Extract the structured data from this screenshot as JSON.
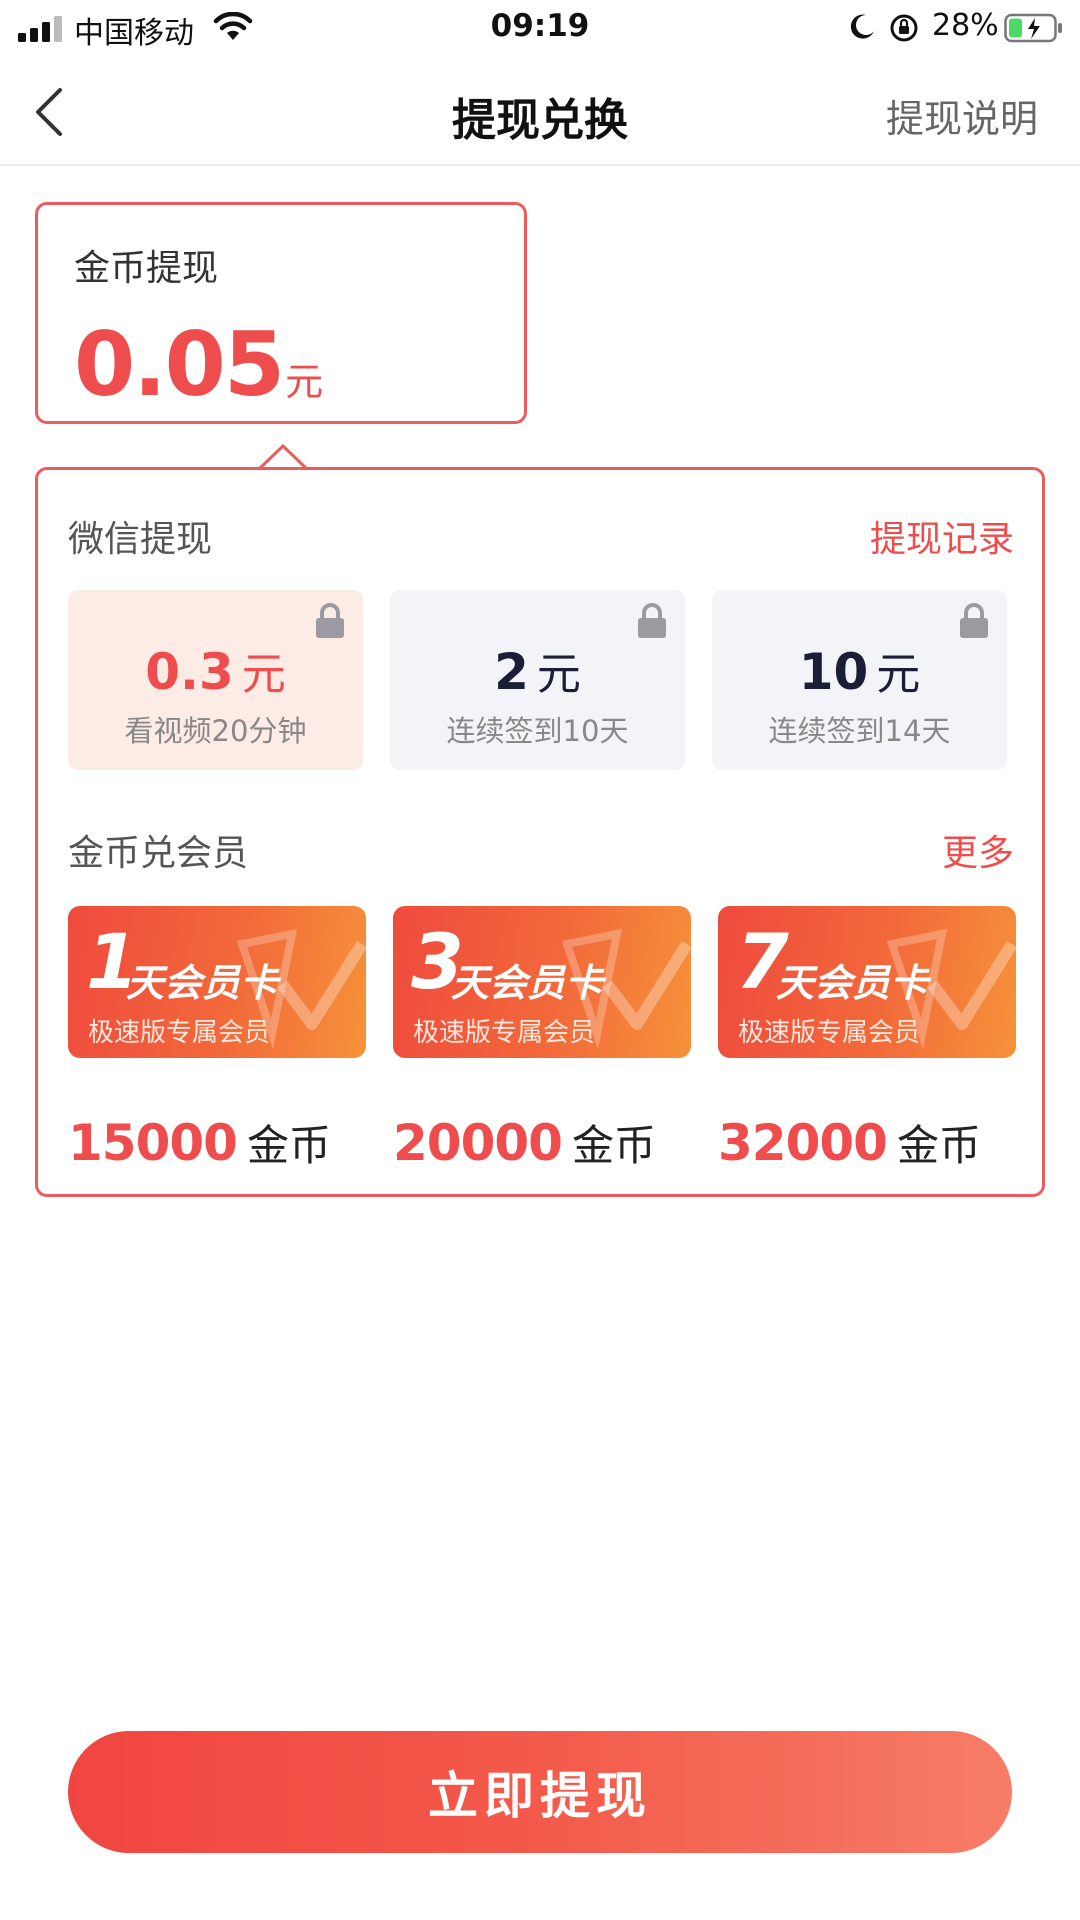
{
  "status_bar": {
    "carrier": "中国移动",
    "time": "09:19",
    "battery": "28%"
  },
  "nav": {
    "title": "提现兑换",
    "right": "提现说明"
  },
  "balance": {
    "label": "金币提现",
    "amount": "0.05",
    "unit": "元"
  },
  "wechat": {
    "title": "微信提现",
    "link": "提现记录",
    "options": [
      {
        "amount": "0.3",
        "unit": "元",
        "desc": "看视频20分钟",
        "selected": true
      },
      {
        "amount": "2",
        "unit": "元",
        "desc": "连续签到10天",
        "selected": false
      },
      {
        "amount": "10",
        "unit": "元",
        "desc": "连续签到14天",
        "selected": false
      }
    ]
  },
  "vip": {
    "title": "金币兑会员",
    "link": "更多",
    "cards": [
      {
        "days": "1",
        "name": "天会员卡",
        "sub": "极速版专属会员",
        "price": "15000",
        "currency": "金币"
      },
      {
        "days": "3",
        "name": "天会员卡",
        "sub": "极速版专属会员",
        "price": "20000",
        "currency": "金币"
      },
      {
        "days": "7",
        "name": "天会员卡",
        "sub": "极速版专属会员",
        "price": "32000",
        "currency": "金币"
      }
    ]
  },
  "cta": {
    "label": "立即提现"
  },
  "colors": {
    "accent": "#ef4d4d",
    "card_gradient_start": "#ef4a3e",
    "card_gradient_end": "#f6923a",
    "option_bg": "#f3f4f8",
    "option_active_bg": "#fdece6"
  }
}
